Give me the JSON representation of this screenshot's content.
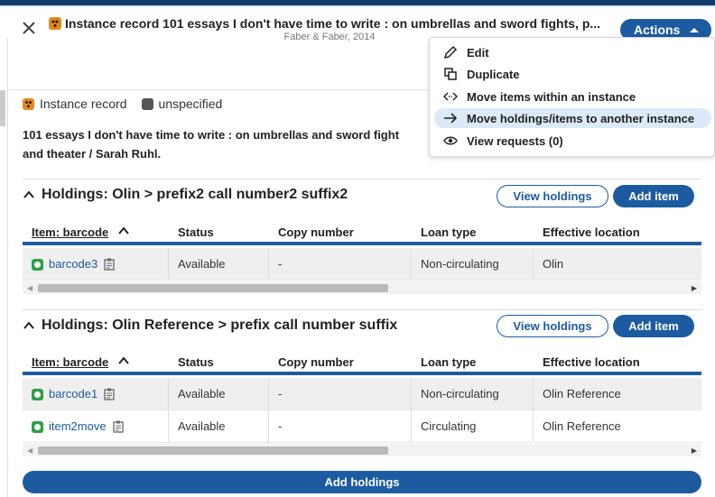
{
  "header": {
    "title": "Instance record 101 essays I don't have time to write : on umbrellas and sword fights, p...",
    "subtitle": "Faber & Faber, 2014",
    "actions_label": "Actions"
  },
  "instance": {
    "type_label": "Instance record",
    "status_label": "unspecified",
    "description_line1": "101 essays I don't have time to write : on umbrellas and sword fight",
    "description_line2": "and theater / Sarah Ruhl."
  },
  "actions_menu": {
    "items": [
      {
        "label": "Edit",
        "icon": "pencil-icon"
      },
      {
        "label": "Duplicate",
        "icon": "duplicate-icon"
      },
      {
        "label": "Move items within an instance",
        "icon": "move-within-icon"
      },
      {
        "label": "Move holdings/items to another instance",
        "icon": "arrow-right-icon"
      },
      {
        "label": "View requests (0)",
        "icon": "eye-icon"
      }
    ]
  },
  "columns": [
    "Item: barcode",
    "Status",
    "Copy number",
    "Loan type",
    "Effective location"
  ],
  "holdings": [
    {
      "title": "Holdings: Olin > prefix2 call number2 suffix2",
      "view_label": "View holdings",
      "add_item_label": "Add item",
      "rows": [
        {
          "barcode": "barcode3",
          "status": "Available",
          "copy": "-",
          "loan": "Non-circulating",
          "location": "Olin"
        }
      ]
    },
    {
      "title": "Holdings: Olin Reference > prefix call number suffix",
      "view_label": "View holdings",
      "add_item_label": "Add item",
      "rows": [
        {
          "barcode": "barcode1",
          "status": "Available",
          "copy": "-",
          "loan": "Non-circulating",
          "location": "Olin Reference"
        },
        {
          "barcode": "item2move",
          "status": "Available",
          "copy": "-",
          "loan": "Circulating",
          "location": "Olin Reference"
        }
      ]
    }
  ],
  "add_holdings_label": "Add holdings",
  "colors": {
    "accent": "#1d5ba1",
    "instance_icon": "#e08a1e",
    "available_icon": "#2f9e44"
  }
}
